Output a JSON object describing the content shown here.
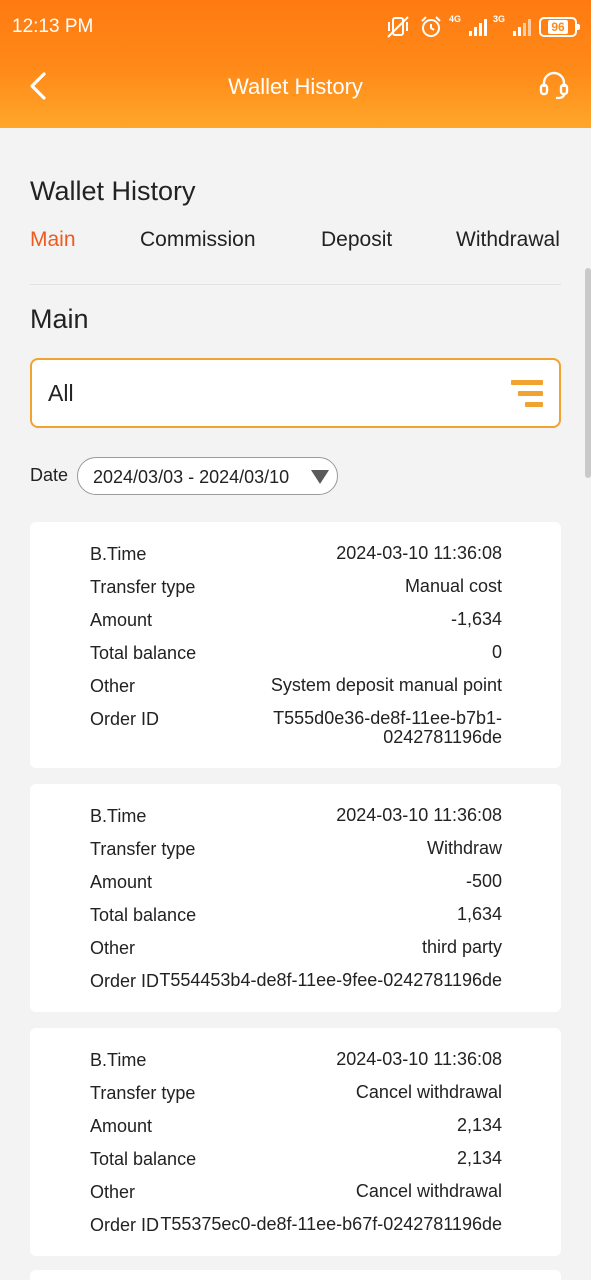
{
  "status_bar": {
    "time": "12:13 PM",
    "signal1_tag": "4G",
    "signal2_tag": "3G",
    "battery": "96",
    "icons": [
      "vibrate-off-icon",
      "alarm-icon",
      "signal-4g-icon",
      "signal-3g-icon",
      "battery-icon"
    ]
  },
  "header": {
    "title": "Wallet History",
    "back_icon": "chevron-left-icon",
    "support_icon": "headset-icon"
  },
  "page": {
    "title": "Wallet History",
    "tabs": [
      {
        "label": "Main",
        "active": true
      },
      {
        "label": "Commission",
        "active": false
      },
      {
        "label": "Deposit",
        "active": false
      },
      {
        "label": "Withdrawal",
        "active": false
      }
    ],
    "section_title": "Main",
    "filter": {
      "value": "All",
      "icon": "filter-lines-icon"
    },
    "date": {
      "label": "Date",
      "value": "2024/03/03 - 2024/03/10"
    }
  },
  "records": [
    {
      "btime_label": "B.Time",
      "btime": "2024-03-10 11:36:08",
      "type_label": "Transfer type",
      "type": "Manual cost",
      "amount_label": "Amount",
      "amount": "-1,634",
      "balance_label": "Total balance",
      "balance": "0",
      "other_label": "Other",
      "other": "System deposit manual point",
      "order_label": "Order ID",
      "order_id_line1": "T555d0e36-de8f-11ee-b7b1-",
      "order_id_line2": "0242781196de"
    },
    {
      "btime_label": "B.Time",
      "btime": "2024-03-10 11:36:08",
      "type_label": "Transfer type",
      "type": "Withdraw",
      "amount_label": "Amount",
      "amount": "-500",
      "balance_label": "Total balance",
      "balance": "1,634",
      "other_label": "Other",
      "other": "third party",
      "order_label": "Order ID",
      "order_id": "T554453b4-de8f-11ee-9fee-0242781196de"
    },
    {
      "btime_label": "B.Time",
      "btime": "2024-03-10 11:36:08",
      "type_label": "Transfer type",
      "type": "Cancel withdrawal",
      "amount_label": "Amount",
      "amount": "2,134",
      "balance_label": "Total balance",
      "balance": "2,134",
      "other_label": "Other",
      "other": "Cancel withdrawal",
      "order_label": "Order ID",
      "order_id": "T55375ec0-de8f-11ee-b67f-0242781196de"
    }
  ],
  "colors": {
    "header_orange": "#ff7a12",
    "active_tab": "#ef5a1e",
    "filter_accent": "#f2a22e",
    "background": "#f3f3f3"
  }
}
